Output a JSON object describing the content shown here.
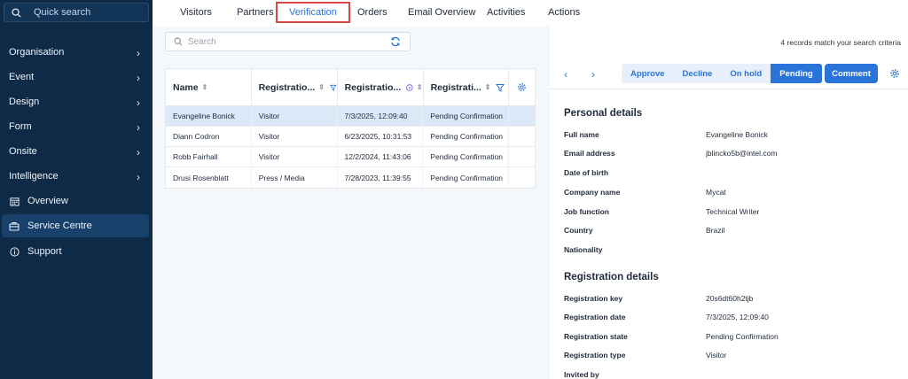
{
  "sidebar": {
    "search_placeholder": "Quick search",
    "items": [
      {
        "label": "Organisation",
        "chevron": true
      },
      {
        "label": "Event",
        "chevron": true
      },
      {
        "label": "Design",
        "chevron": true
      },
      {
        "label": "Form",
        "chevron": true
      },
      {
        "label": "Onsite",
        "chevron": true
      },
      {
        "label": "Intelligence",
        "chevron": true
      },
      {
        "label": "Overview",
        "icon": "calendar-icon"
      },
      {
        "label": "Service Centre",
        "icon": "briefcase-icon",
        "active": true
      },
      {
        "label": "Support",
        "icon": "info-icon"
      }
    ]
  },
  "tabs": [
    "Visitors",
    "Partners",
    "Verification",
    "Orders",
    "Email Overview",
    "Activities",
    "Actions"
  ],
  "active_tab": "Verification",
  "search": {
    "placeholder": "Search"
  },
  "match_text": "4 records match your search criteria",
  "table": {
    "headers": [
      "Name",
      "Registratio...",
      "Registratio...",
      "Registrati..."
    ],
    "rows": [
      [
        "Evangeline Bonick",
        "Visitor",
        "7/3/2025, 12:09:40",
        "Pending Confirmation"
      ],
      [
        "Diann Codron",
        "Visitor",
        "6/23/2025, 10:31:53",
        "Pending Confirmation"
      ],
      [
        "Robb Fairhall",
        "Visitor",
        "12/2/2024, 11:43:06",
        "Pending Confirmation"
      ],
      [
        "Drusi Rosenblatt",
        "Press / Media",
        "7/28/2023, 11:39:55",
        "Pending Confirmation"
      ]
    ],
    "selected_row": 0
  },
  "toolbar": {
    "prev": "‹",
    "next": "›",
    "segments": [
      "Approve",
      "Decline",
      "On hold",
      "Pending"
    ],
    "active_segment": "Pending",
    "comment_label": "Comment"
  },
  "personal": {
    "title": "Personal details",
    "fields": [
      {
        "label": "Full name",
        "value": "Evangeline Bonick"
      },
      {
        "label": "Email address",
        "value": "jblincko5b@intel.com"
      },
      {
        "label": "Date of birth",
        "value": ""
      },
      {
        "label": "Company name",
        "value": "Mycat"
      },
      {
        "label": "Job function",
        "value": "Technical Writer"
      },
      {
        "label": "Country",
        "value": "Brazil"
      },
      {
        "label": "Nationality",
        "value": ""
      }
    ]
  },
  "registration": {
    "title": "Registration details",
    "fields": [
      {
        "label": "Registration key",
        "value": "20s6dt60h2tjb"
      },
      {
        "label": "Registration date",
        "value": "7/3/2025, 12:09:40"
      },
      {
        "label": "Registration state",
        "value": "Pending Confirmation"
      },
      {
        "label": "Registration type",
        "value": "Visitor"
      },
      {
        "label": "Invited by",
        "value": ""
      }
    ]
  },
  "colors": {
    "sidebar": "#0e2a47",
    "accent": "#2a74d9",
    "highlight": "#d94747"
  }
}
